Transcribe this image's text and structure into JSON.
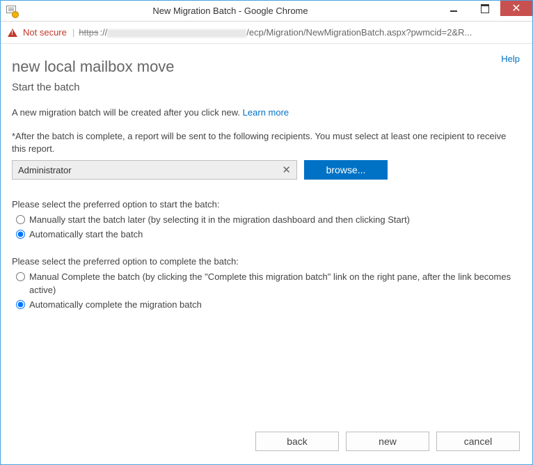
{
  "window": {
    "title": "New Migration Batch - Google Chrome"
  },
  "addressbar": {
    "not_secure": "Not secure",
    "https_prefix": "https",
    "url_suffix": "/ecp/Migration/NewMigrationBatch.aspx?pwmcid=2&R..."
  },
  "help": "Help",
  "page": {
    "title": "new local mailbox move",
    "subtitle": "Start the batch",
    "intro_text": "A new migration batch will be created after you click new. ",
    "learn_more": "Learn more",
    "recipient_label": "*After the batch is complete, a report will be sent to the following recipients. You must select at least one recipient to receive this report.",
    "recipient_value": "Administrator",
    "browse_label": "browse...",
    "start_section": {
      "label": "Please select the preferred option to start the batch:",
      "opt_manual": "Manually start the batch later (by selecting it in the migration dashboard and then clicking Start)",
      "opt_auto": "Automatically start the batch",
      "selected": "auto"
    },
    "complete_section": {
      "label": "Please select the preferred option to complete the batch:",
      "opt_manual": "Manual Complete the batch (by clicking the \"Complete this migration batch\" link on the right pane, after the link becomes active)",
      "opt_auto": "Automatically complete the migration batch",
      "selected": "auto"
    }
  },
  "footer": {
    "back": "back",
    "new": "new",
    "cancel": "cancel"
  }
}
